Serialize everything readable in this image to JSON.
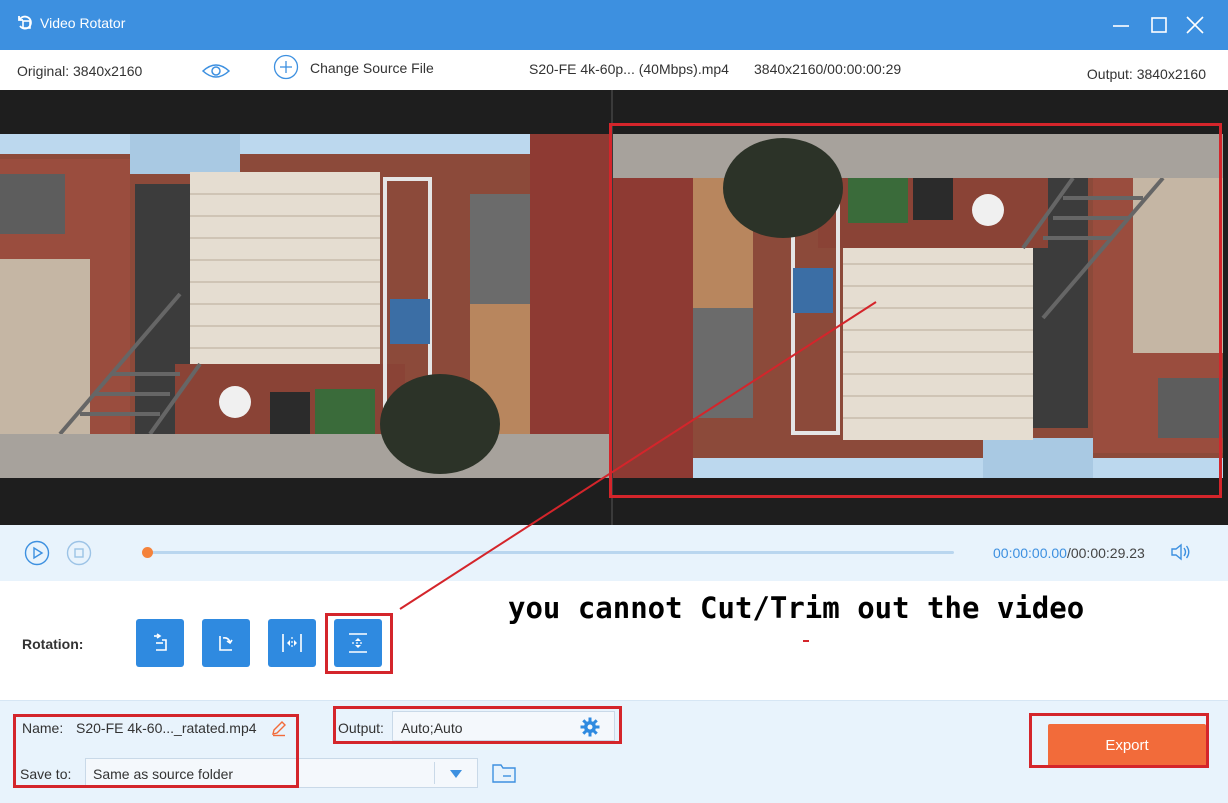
{
  "window": {
    "title": "Video Rotator"
  },
  "infobar": {
    "original_label": "Original: 3840x2160",
    "change_source_label": "Change Source File",
    "file_name": "S20-FE 4k-60p... (40Mbps).mp4",
    "file_meta": "3840x2160/00:00:00:29",
    "output_label": "Output: 3840x2160"
  },
  "playback": {
    "current_time": "00:00:00.00",
    "separator": "/",
    "total_time": "00:00:29.23",
    "progress": 0.0
  },
  "rotation": {
    "label": "Rotation:",
    "buttons": [
      {
        "name": "rotate-left",
        "icon": "rotate-ccw-icon"
      },
      {
        "name": "rotate-right",
        "icon": "rotate-cw-icon"
      },
      {
        "name": "flip-horizontal",
        "icon": "flip-horizontal-icon"
      },
      {
        "name": "flip-vertical",
        "icon": "flip-vertical-icon",
        "selected": true
      }
    ]
  },
  "annotation": {
    "note": "you cannot Cut/Trim out the video",
    "color": "#d4252b"
  },
  "bottom": {
    "name_label": "Name:",
    "name_value": "S20-FE 4k-60..._ratated.mp4",
    "save_to_label": "Save to:",
    "save_to_value": "Same as source folder",
    "output_label": "Output:",
    "output_value": "Auto;Auto",
    "export_label": "Export"
  },
  "colors": {
    "titlebar": "#3d90e0",
    "accent": "#2f8ae0",
    "export": "#f26b3a",
    "progress_thumb": "#f4823b"
  }
}
